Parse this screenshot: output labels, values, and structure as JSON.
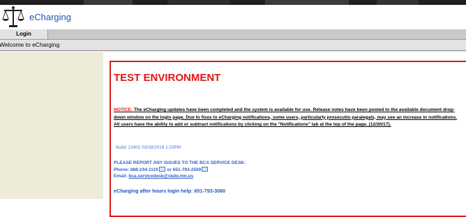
{
  "app": {
    "title": "eCharging",
    "logo_icon": "scales-of-justice-icon"
  },
  "menu": {
    "tabs": [
      {
        "label": "Login"
      }
    ]
  },
  "welcome": "Welcome to eCharging",
  "main": {
    "heading": "TEST ENVIRONMENT",
    "notice_label": "NOTICE:",
    "notice_text": "The eCharging updates have been completed and the system is available for use.  Release notes have been posted to the available document drop-down window on the login page.  Due to fixes to eCharging notifications, some users, particularly prosecutio paralegals, may see an increase in notifications.  All users have the ability to add or subtract notifications by clicking on the \"Notifications\" tab at the top of the page.  (12/20/17).",
    "build": "Build: 21901 03/28/2019 1:20PM",
    "report_heading": "PLEASE REPORT ANY ISSUES TO THE BCA SERVICE DESK:",
    "phone_label": "Phone:",
    "phone_1": "888-234-1119",
    "phone_or": "or",
    "phone_2": "651-793-2500",
    "email_label": "Email:",
    "email": "bca.servicedesk@state.mn.us",
    "after_hours": "eCharging after hours login help: 651-793-3060"
  },
  "colors": {
    "accent_red": "#e01616",
    "link_blue": "#2f5fc4",
    "sidebar_bg": "#eeebd9",
    "menubar_bg": "#c9c9c9"
  }
}
